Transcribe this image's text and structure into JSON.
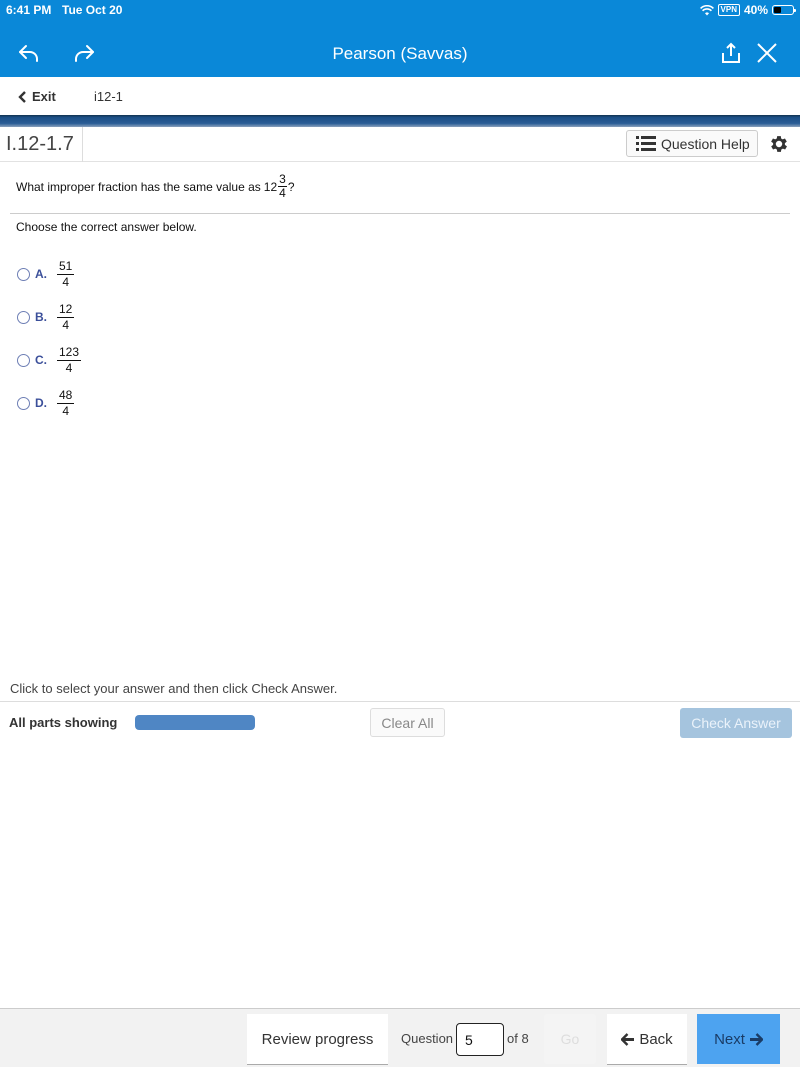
{
  "status_bar": {
    "time": "6:41 PM",
    "date": "Tue Oct 20",
    "vpn": "VPN",
    "battery": "40%",
    "battery_level": 0.4
  },
  "app_bar": {
    "title": "Pearson (Savvas)",
    "icons": [
      "undo-icon",
      "redo-icon",
      "share-icon",
      "close-icon"
    ],
    "background": "#0a88d8"
  },
  "nav": {
    "exit_label": "Exit",
    "breadcrumb": "i12-1"
  },
  "question_header": {
    "id": "I.12-1.7",
    "help_label": "Question Help"
  },
  "question": {
    "text": "What improper fraction has the same value as",
    "whole": "12",
    "numerator": "3",
    "denominator": "4",
    "suffix": "?",
    "instruction": "Choose the correct answer below."
  },
  "options": [
    {
      "letter": "A.",
      "numerator": "51",
      "denominator": "4"
    },
    {
      "letter": "B.",
      "numerator": "12",
      "denominator": "4"
    },
    {
      "letter": "C.",
      "numerator": "123",
      "denominator": "4"
    },
    {
      "letter": "D.",
      "numerator": "48",
      "denominator": "4"
    }
  ],
  "answer_area": {
    "hint": "Click to select your answer and then click Check Answer.",
    "parts_label": "All parts showing",
    "clear_all": "Clear All",
    "check_answer": "Check Answer"
  },
  "footer": {
    "review_progress": "Review progress",
    "question_label": "Question",
    "question_number": "5",
    "of_label": "of 8",
    "go_label": "Go",
    "back_label": "Back",
    "next_label": "Next"
  }
}
